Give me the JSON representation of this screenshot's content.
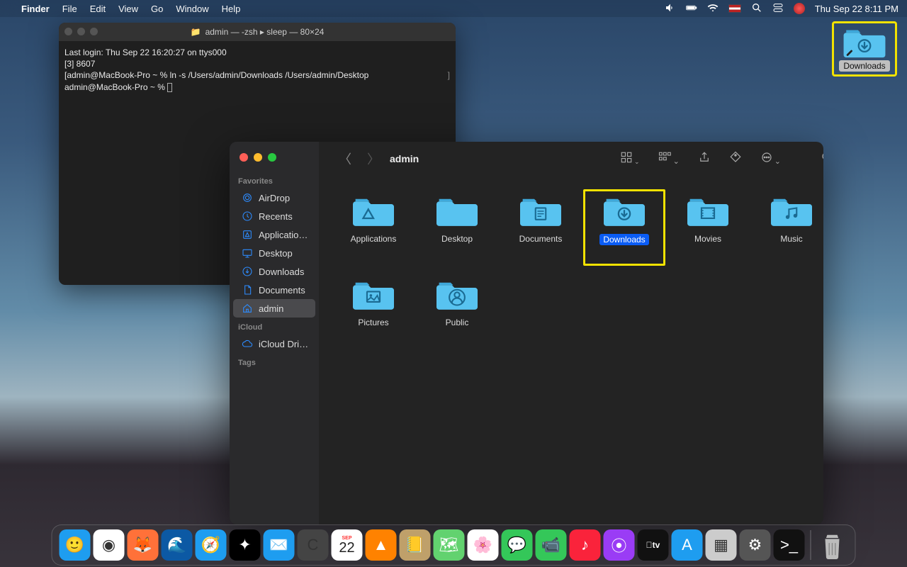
{
  "menubar": {
    "app": "Finder",
    "items": [
      "File",
      "Edit",
      "View",
      "Go",
      "Window",
      "Help"
    ],
    "clock": "Thu Sep 22  8:11 PM"
  },
  "desktop_icon": {
    "label": "Downloads"
  },
  "terminal": {
    "title": "admin — -zsh ▸ sleep — 80×24",
    "lines": [
      "Last login: Thu Sep 22 16:20:27 on ttys000",
      "[3] 8607",
      "[admin@MacBook-Pro ~ % ln -s /Users/admin/Downloads /Users/admin/Desktop",
      "admin@MacBook-Pro ~ % "
    ]
  },
  "finder": {
    "title": "admin",
    "sidebar": {
      "favorites_label": "Favorites",
      "icloud_label": "iCloud",
      "tags_label": "Tags",
      "favorites": [
        {
          "label": "AirDrop",
          "icon": "airdrop"
        },
        {
          "label": "Recents",
          "icon": "clock"
        },
        {
          "label": "Applicatio…",
          "icon": "apps"
        },
        {
          "label": "Desktop",
          "icon": "desktop"
        },
        {
          "label": "Downloads",
          "icon": "download"
        },
        {
          "label": "Documents",
          "icon": "doc"
        },
        {
          "label": "admin",
          "icon": "home",
          "active": true
        }
      ],
      "icloud": [
        {
          "label": "iCloud Dri…",
          "icon": "cloud"
        }
      ]
    },
    "folders": [
      {
        "label": "Applications",
        "icon": "apps"
      },
      {
        "label": "Desktop",
        "icon": "desktop"
      },
      {
        "label": "Documents",
        "icon": "doc"
      },
      {
        "label": "Downloads",
        "icon": "download",
        "selected": true
      },
      {
        "label": "Movies",
        "icon": "movie"
      },
      {
        "label": "Music",
        "icon": "music"
      },
      {
        "label": "Pictures",
        "icon": "picture"
      },
      {
        "label": "Public",
        "icon": "public"
      }
    ]
  },
  "dock": {
    "apps": [
      "finder",
      "chrome",
      "firefox",
      "edge",
      "safari",
      "siri",
      "mail",
      "calc",
      "calendar",
      "vlc",
      "contacts",
      "maps",
      "photos",
      "messages",
      "facetime",
      "music",
      "podcasts",
      "tv",
      "appstore",
      "launchpad",
      "settings",
      "terminal"
    ],
    "calendar_day": "22",
    "calendar_month": "SEP"
  }
}
